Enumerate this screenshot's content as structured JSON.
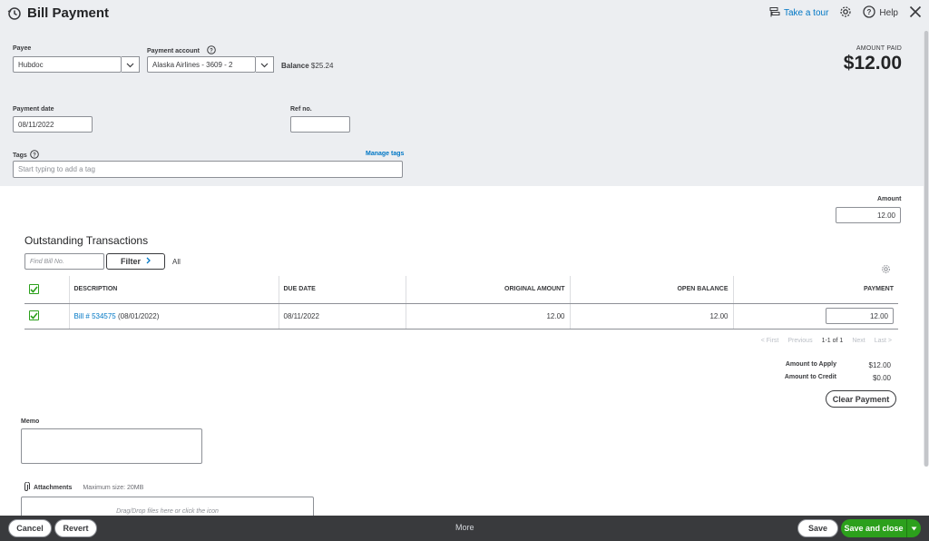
{
  "header": {
    "title": "Bill Payment",
    "take_tour": "Take a tour",
    "help": "Help"
  },
  "form": {
    "payee_label": "Payee",
    "payee_value": "Hubdoc",
    "payment_account_label": "Payment account",
    "payment_account_value": "Alaska Airlines - 3609 - 2",
    "balance_label": "Balance",
    "balance_value": "$25.24",
    "amount_paid_label": "AMOUNT PAID",
    "amount_paid_value": "$12.00",
    "payment_date_label": "Payment date",
    "payment_date_value": "08/11/2022",
    "ref_label": "Ref no.",
    "ref_value": "",
    "tags_label": "Tags",
    "manage_tags": "Manage tags",
    "tags_placeholder": "Start typing to add a tag"
  },
  "amount": {
    "label": "Amount",
    "value": "12.00"
  },
  "outstanding": {
    "title": "Outstanding Transactions",
    "find_placeholder": "Find Bill No.",
    "filter_label": "Filter",
    "all_label": "All",
    "columns": [
      "DESCRIPTION",
      "DUE DATE",
      "ORIGINAL AMOUNT",
      "OPEN BALANCE",
      "PAYMENT"
    ],
    "rows": [
      {
        "link": "Bill # 534575",
        "date_suffix": " (08/01/2022)",
        "due_date": "08/11/2022",
        "original": "12.00",
        "open": "12.00",
        "payment": "12.00"
      }
    ],
    "pager": {
      "first": "< First",
      "previous": "Previous",
      "current": "1-1 of 1",
      "next": "Next",
      "last": "Last >"
    }
  },
  "totals": {
    "apply_label": "Amount to Apply",
    "apply_value": "$12.00",
    "credit_label": "Amount to Credit",
    "credit_value": "$0.00",
    "clear_payment": "Clear Payment"
  },
  "memo": {
    "label": "Memo"
  },
  "attachments": {
    "label": "Attachments",
    "max_size": "Maximum size: 20MB",
    "drop_text": "Drag/Drop files here or click the icon"
  },
  "footer": {
    "cancel": "Cancel",
    "revert": "Revert",
    "more": "More",
    "save": "Save",
    "save_close": "Save and close"
  },
  "colors": {
    "accent_green": "#2ca01c",
    "link_blue": "#0077c5",
    "footer_bg": "#393a3d",
    "header_bg": "#eceef1"
  }
}
